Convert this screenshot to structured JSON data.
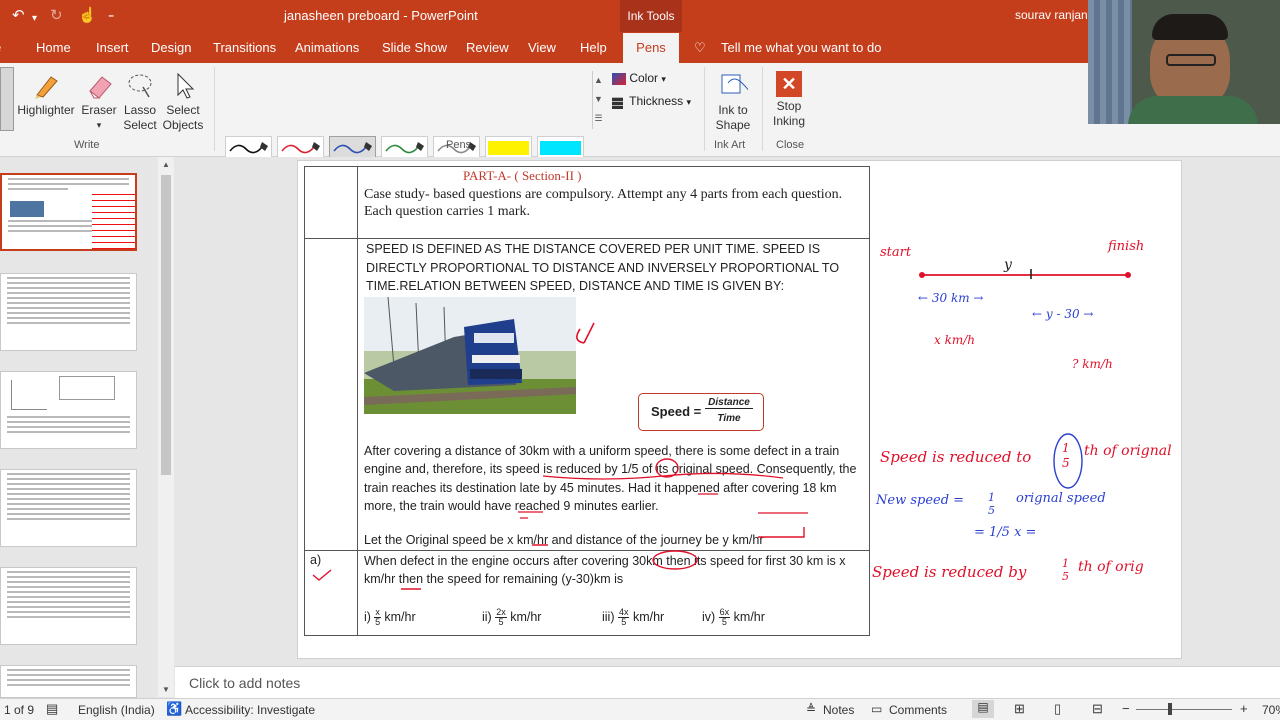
{
  "app": {
    "title": "janasheen preboard  -  PowerPoint",
    "context_tab": "Ink Tools",
    "user": "sourav ranjan"
  },
  "tabs": [
    "Home",
    "Insert",
    "Design",
    "Transitions",
    "Animations",
    "Slide Show",
    "Review",
    "View",
    "Help",
    "Pens"
  ],
  "tell_me": "Tell me what you want to do",
  "ribbon": {
    "write": {
      "label": "Write",
      "highlighter": "Highlighter",
      "eraser": "Eraser",
      "lasso": "Lasso Select",
      "select_objects": "Select Objects"
    },
    "pens": {
      "label": "Pens",
      "row1": [
        {
          "color": "#111111"
        },
        {
          "color": "#d9232f"
        },
        {
          "color": "#2c4fb5"
        },
        {
          "color": "#2e8b3e"
        },
        {
          "color": "#8a8a8a"
        },
        {
          "color": "#fff200"
        },
        {
          "color": "#00e5ff"
        }
      ],
      "row2": [
        {
          "color": "#111111"
        },
        {
          "color": "#d9232f"
        },
        {
          "color": "#2c4fb5"
        },
        {
          "color": "#2e8b3e"
        },
        {
          "color": "#8a8a8a"
        },
        {
          "color": "#66e617"
        },
        {
          "color": "#ff14d8"
        }
      ],
      "color_label": "Color",
      "thickness_label": "Thickness"
    },
    "ink_art": {
      "label": "Ink Art",
      "ink_to_shape": "Ink to Shape"
    },
    "close": {
      "label": "Close",
      "stop_inking": "Stop Inking"
    }
  },
  "slide": {
    "part_header": "PART-A- ( Section-II )",
    "instructions": "Case study- based questions are compulsory. Attempt any 4 parts from each question. Each question carries 1 mark.",
    "definition": "SPEED IS DEFINED AS THE DISTANCE COVERED PER UNIT TIME. SPEED IS DIRECTLY PROPORTIONAL TO DISTANCE AND INVERSELY PROPORTIONAL TO TIME.RELATION BETWEEN SPEED, DISTANCE AND TIME IS GIVEN BY:",
    "formula": {
      "lhs": "Speed =",
      "num": "Distance",
      "den": "Time"
    },
    "case_text": "After covering a distance of 30km with a uniform speed, there is some defect in a train engine and, therefore, its speed is reduced by 1/5 of its original speed. Consequently, the train reaches its destination late by 45 minutes. Had it happened after covering 18 km more, the train would have reached 9 minutes earlier.",
    "let_text": "Let the Original speed be x km/hr and distance of the journey be y km/hr",
    "q_label": "a)",
    "q_text": "When defect in the engine occurs after covering 30km then its speed for first 30 km is x km/hr then the speed for remaining (y-30)km is",
    "options": [
      {
        "label": "i)",
        "num": "x",
        "den": "5",
        "unit": "km/hr"
      },
      {
        "label": "ii)",
        "num": "2x",
        "den": "5",
        "unit": "km/hr"
      },
      {
        "label": "iii)",
        "num": "4x",
        "den": "5",
        "unit": "km/hr"
      },
      {
        "label": "iv)",
        "num": "6x",
        "den": "5",
        "unit": "km/hr"
      }
    ]
  },
  "ink": {
    "start": "start",
    "finish": "finish",
    "y": "y",
    "km30": "← 30 km →",
    "y30": "← y - 30 →",
    "xkmh": "x km/h",
    "qkmh": "? km/h",
    "reduced1": "Speed is reduced to",
    "frac_num": "1",
    "frac_den": "5",
    "th_orig": "th of orignal",
    "new_speed": "New speed =",
    "orig_speed": "orignal speed",
    "eq2": "= 1/5 x =",
    "reduced2": "Speed is reduced by",
    "th_orig2": "th of orig"
  },
  "notes_placeholder": "Click to add notes",
  "status": {
    "slide_count": "1 of 9",
    "language": "English (India)",
    "accessibility": "Accessibility: Investigate",
    "notes": "Notes",
    "comments": "Comments",
    "zoom": "70%"
  }
}
